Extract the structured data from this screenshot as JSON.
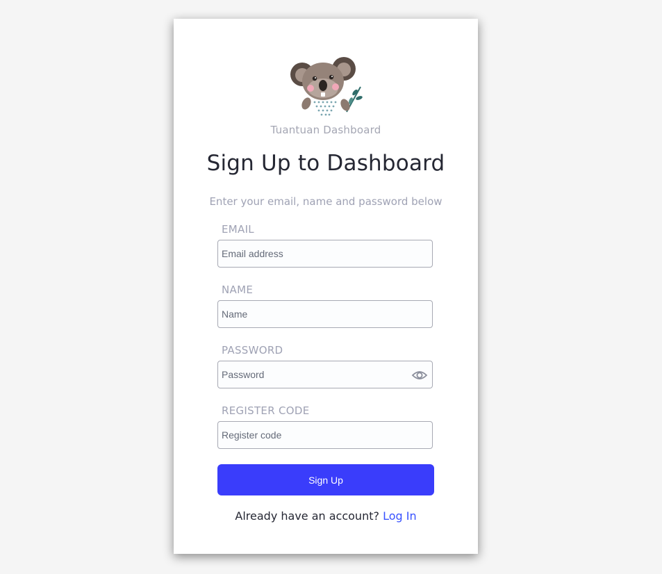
{
  "brand": {
    "name": "Tuantuan Dashboard",
    "logo_icon": "koala-icon"
  },
  "heading": {
    "title": "Sign Up to Dashboard",
    "subtitle": "Enter your email, name and password below"
  },
  "form": {
    "email": {
      "label": "EMAIL",
      "placeholder": "Email address",
      "value": ""
    },
    "name": {
      "label": "NAME",
      "placeholder": "Name",
      "value": ""
    },
    "password": {
      "label": "PASSWORD",
      "placeholder": "Password",
      "value": "",
      "toggle_icon": "eye-icon"
    },
    "register_code": {
      "label": "REGISTER CODE",
      "placeholder": "Register code",
      "value": ""
    },
    "submit_label": "Sign Up"
  },
  "footer": {
    "prompt": "Already have an account?",
    "link_label": "Log In"
  },
  "colors": {
    "accent": "#3a3dfb",
    "link": "#3751ff",
    "background": "#f5f5f5"
  }
}
